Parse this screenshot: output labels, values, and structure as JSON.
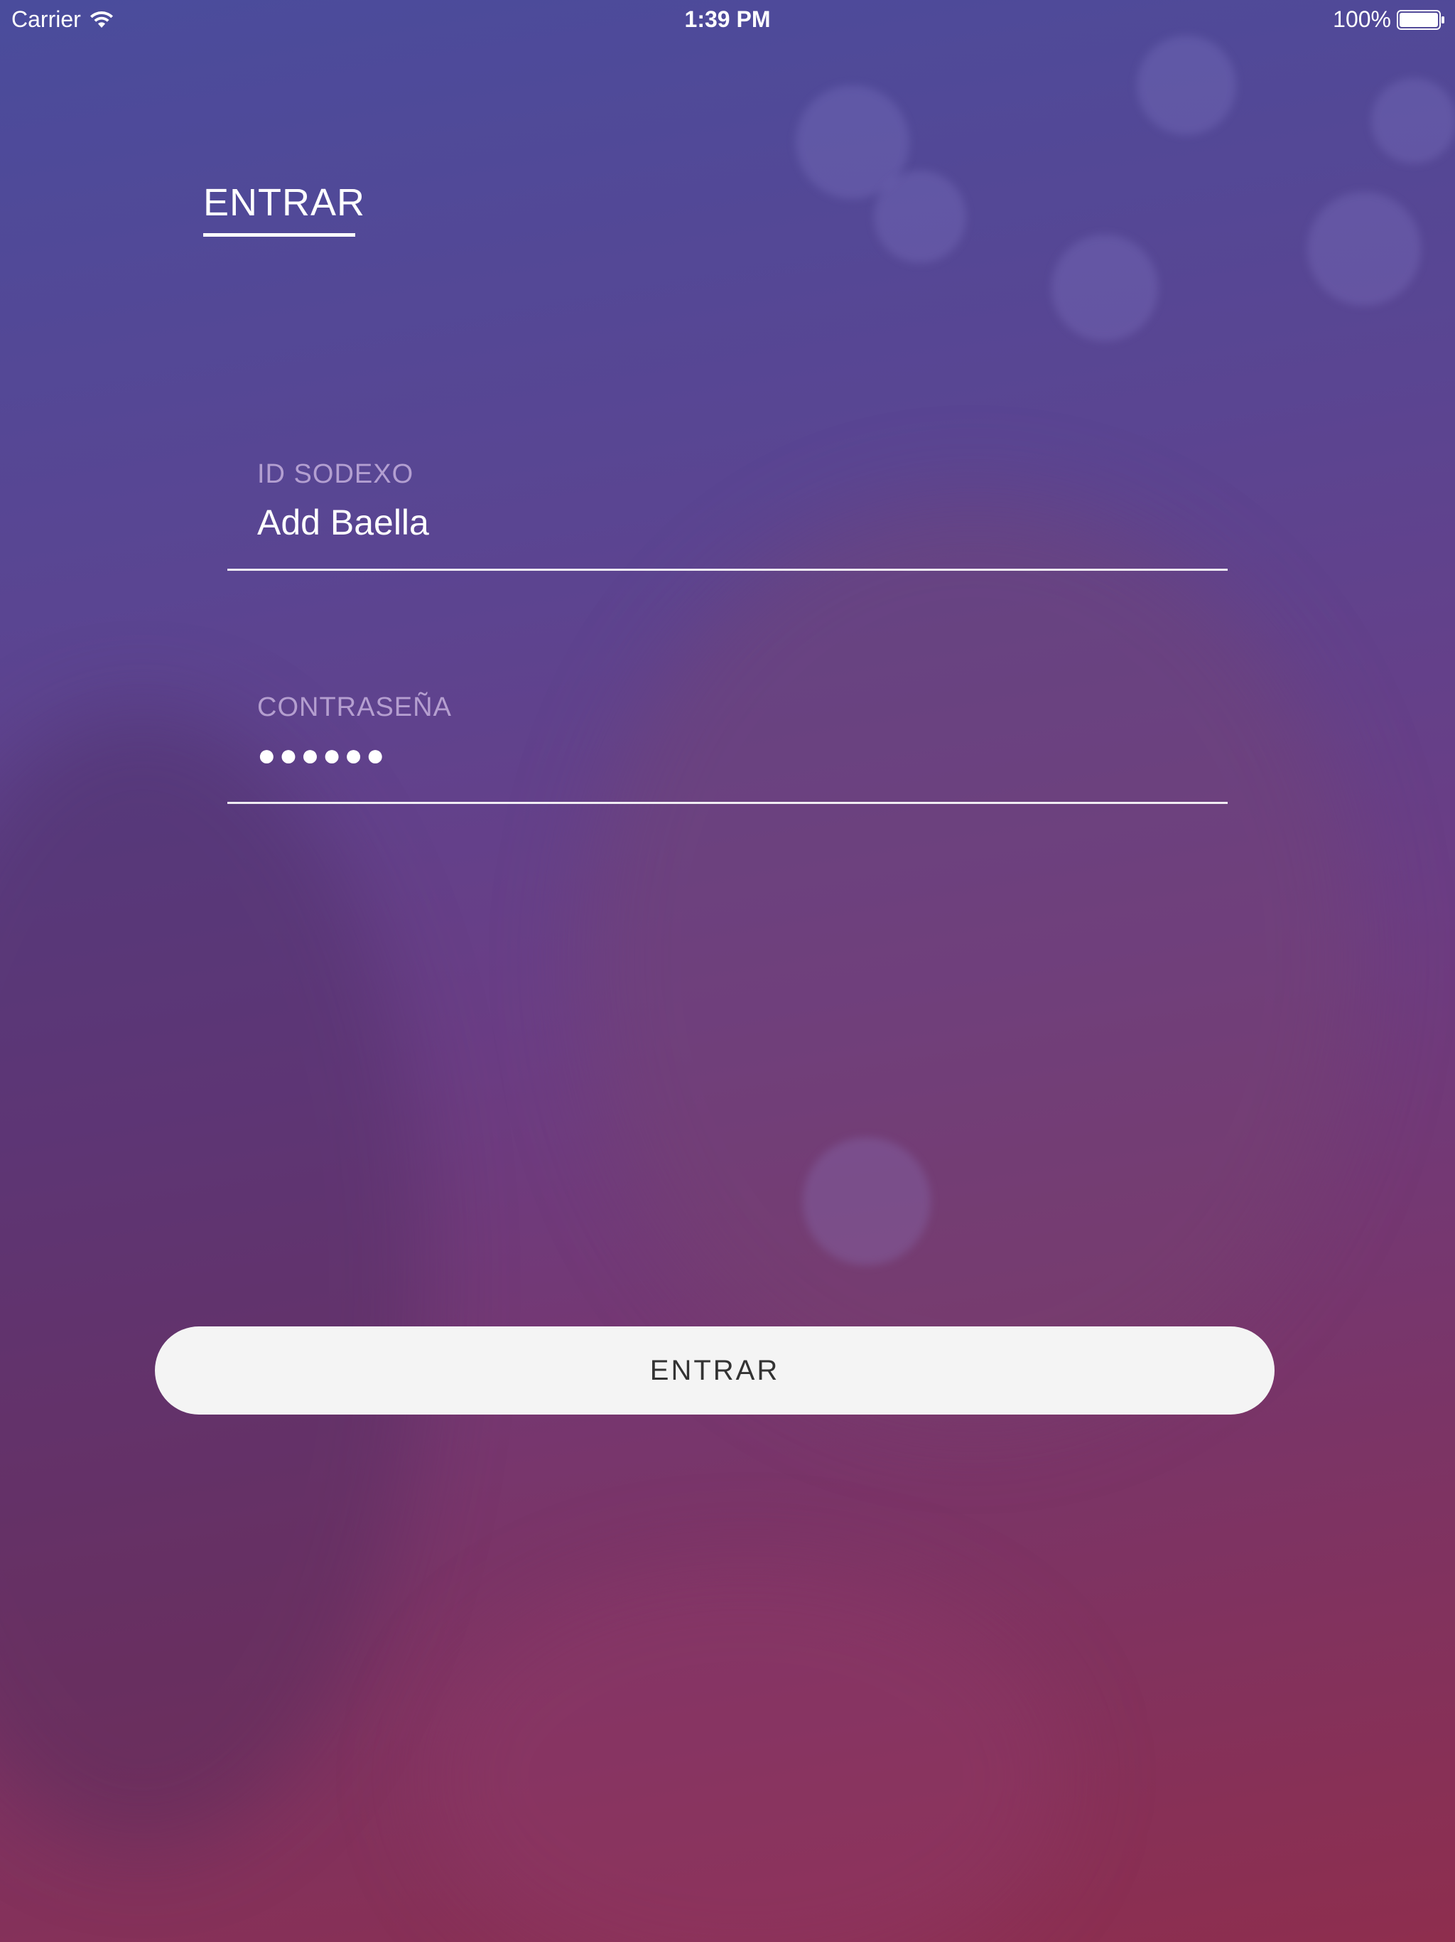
{
  "status_bar": {
    "carrier": "Carrier",
    "time": "1:39 PM",
    "battery_percent": "100%",
    "battery_level": 1.0,
    "icons": [
      "wifi-icon",
      "battery-icon"
    ]
  },
  "header": {
    "title": "ENTRAR"
  },
  "form": {
    "id_field": {
      "label": "ID SODEXO",
      "value": "Add Baella"
    },
    "password_field": {
      "label": "CONTRASEÑA",
      "value": "●●●●●●"
    }
  },
  "submit": {
    "label": "ENTRAR"
  },
  "colors": {
    "gradient_top": "#4a4c9c",
    "gradient_bottom": "#8e2e4e",
    "button_bg": "#f4f4f4",
    "button_text": "#333333",
    "label_text": "#d2bee6"
  }
}
